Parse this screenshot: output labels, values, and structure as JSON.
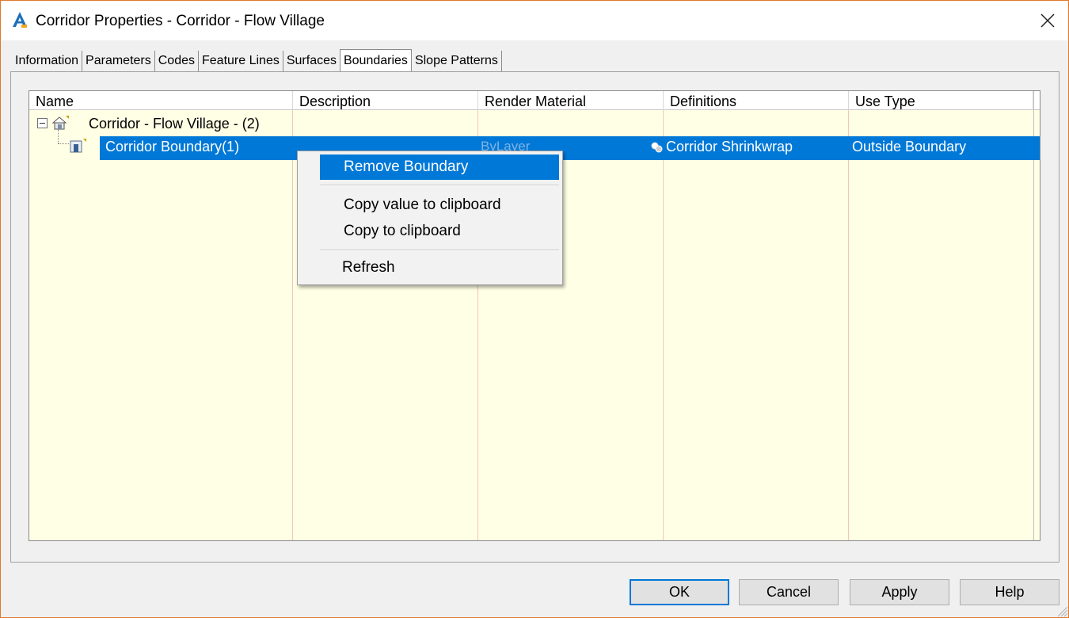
{
  "window": {
    "title": "Corridor Properties - Corridor - Flow Village",
    "accent_color": "#e0792b",
    "icons": {
      "app": "autocad-civil3d-app-icon",
      "close": "close-icon"
    }
  },
  "tabs": [
    {
      "label": "Information"
    },
    {
      "label": "Parameters"
    },
    {
      "label": "Codes"
    },
    {
      "label": "Feature Lines"
    },
    {
      "label": "Surfaces"
    },
    {
      "label": "Boundaries",
      "active": true
    },
    {
      "label": "Slope Patterns"
    }
  ],
  "grid": {
    "columns": [
      "Name",
      "Description",
      "Render Material",
      "Definitions",
      "Use Type"
    ],
    "rows": [
      {
        "name": "Corridor - Flow Village - (2)",
        "expanded": true,
        "icon": "corridor-icon"
      },
      {
        "name": "Corridor Boundary(1)",
        "description": "",
        "render_material": "ByLayer",
        "definitions": "Corridor Shrinkwrap",
        "use_type": "Outside Boundary",
        "selected": true,
        "icon": "boundary-icon"
      }
    ],
    "background_color": "#ffffe6",
    "selection_color": "#0078d7"
  },
  "context_menu": {
    "items": [
      {
        "label": "Remove Boundary",
        "highlighted": true
      },
      {
        "label": "Copy value to clipboard"
      },
      {
        "label": "Copy to clipboard"
      },
      {
        "label": "Refresh"
      }
    ]
  },
  "buttons": {
    "ok": "OK",
    "cancel": "Cancel",
    "apply": "Apply",
    "help": "Help"
  }
}
